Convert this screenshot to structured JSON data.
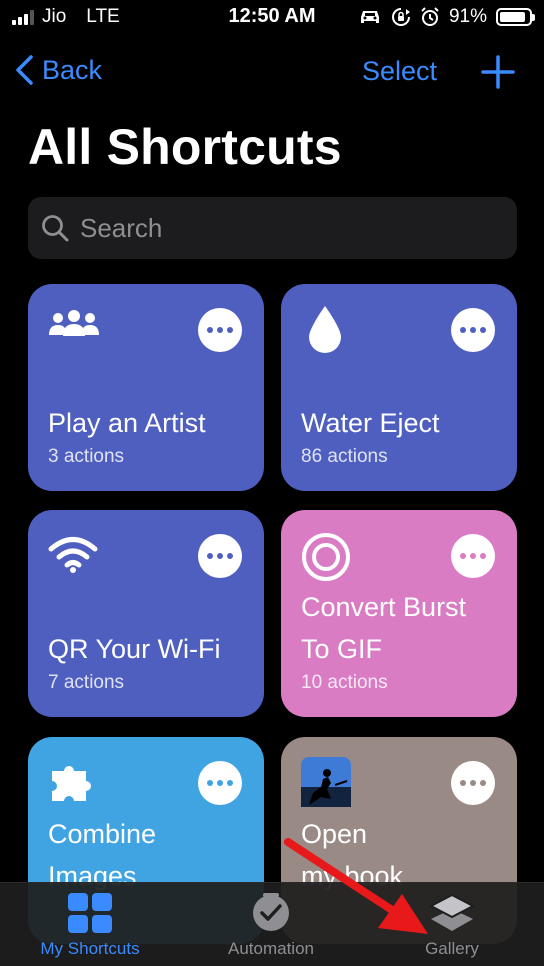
{
  "status_bar": {
    "carrier": "Jio",
    "network": "LTE",
    "time": "12:50 AM",
    "battery": "91%",
    "battery_level": 0.91
  },
  "nav": {
    "back_label": "Back",
    "select_label": "Select"
  },
  "page": {
    "title": "All Shortcuts"
  },
  "search": {
    "placeholder": "Search"
  },
  "shortcuts": [
    {
      "title": "Play an Artist",
      "subtitle": "3 actions",
      "icon": "people-icon",
      "color": "#4f5fc0"
    },
    {
      "title": "Water Eject",
      "subtitle": "86 actions",
      "icon": "water-drop-icon",
      "color": "#4f5fc0"
    },
    {
      "title": "QR Your Wi-Fi",
      "subtitle": "7 actions",
      "icon": "wifi-icon",
      "color": "#4f5fc0"
    },
    {
      "title_line1": "Convert Burst",
      "title_line2": "To GIF",
      "subtitle": "10 actions",
      "icon": "target-icon",
      "color": "#d97cc4"
    },
    {
      "title_line1": "Combine",
      "title_line2": "Images",
      "icon": "puzzle-icon",
      "color": "#40a4e3"
    },
    {
      "title_line1": "Open",
      "title_line2": "my book",
      "icon": "kindle-icon",
      "color": "#9a8a86"
    }
  ],
  "tabbar": {
    "tabs": [
      {
        "label": "My Shortcuts",
        "icon": "grid-icon",
        "active": true
      },
      {
        "label": "Automation",
        "icon": "clock-check-icon",
        "active": false
      },
      {
        "label": "Gallery",
        "icon": "layers-icon",
        "active": false
      }
    ]
  },
  "colors": {
    "accent": "#3a8bff",
    "arrow": "#e8191a"
  }
}
